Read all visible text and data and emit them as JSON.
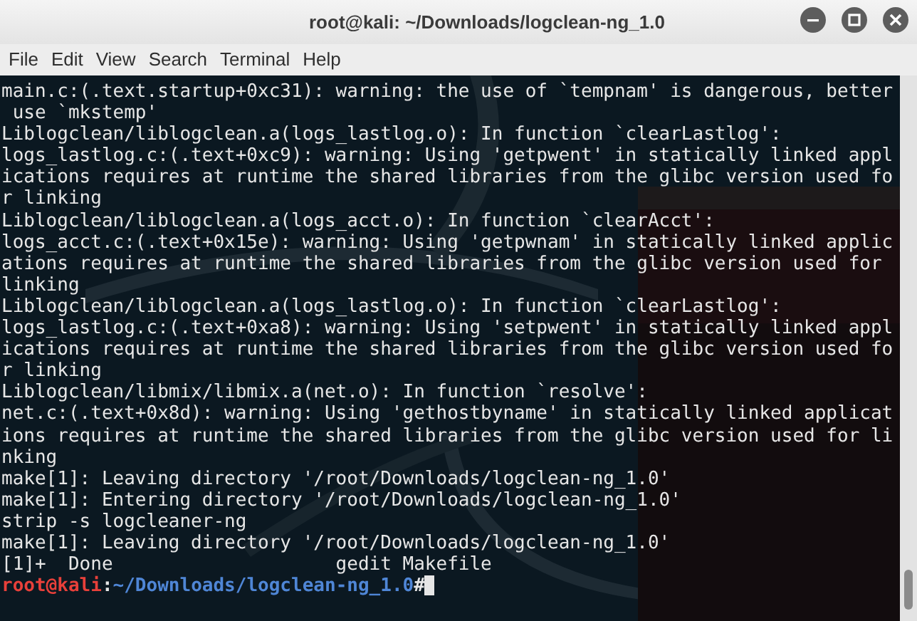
{
  "window": {
    "title": "root@kali: ~/Downloads/logclean-ng_1.0",
    "controls": [
      {
        "kind": "minimize"
      },
      {
        "kind": "maximize"
      },
      {
        "kind": "close"
      }
    ]
  },
  "menu": [
    "File",
    "Edit",
    "View",
    "Search",
    "Terminal",
    "Help"
  ],
  "lines": [
    "main.c:(.text.startup+0xc31): warning: the use of `tempnam' is dangerous, better",
    " use `mkstemp'",
    "Liblogclean/liblogclean.a(logs_lastlog.o): In function `clearLastlog':",
    "logs_lastlog.c:(.text+0xc9): warning: Using 'getpwent' in statically linked appl",
    "ications requires at runtime the shared libraries from the glibc version used fo",
    "r linking",
    "Liblogclean/liblogclean.a(logs_acct.o): In function `clearAcct':",
    "logs_acct.c:(.text+0x15e): warning: Using 'getpwnam' in statically linked applic",
    "ations requires at runtime the shared libraries from the glibc version used for",
    "linking",
    "Liblogclean/liblogclean.a(logs_lastlog.o): In function `clearLastlog':",
    "logs_lastlog.c:(.text+0xa8): warning: Using 'setpwent' in statically linked appl",
    "ications requires at runtime the shared libraries from the glibc version used fo",
    "r linking",
    "Liblogclean/libmix/libmix.a(net.o): In function `resolve':",
    "net.c:(.text+0x8d): warning: Using 'gethostbyname' in statically linked applicat",
    "ions requires at runtime the shared libraries from the glibc version used for li",
    "nking",
    "make[1]: Leaving directory '/root/Downloads/logclean-ng_1.0'",
    "make[1]: Entering directory '/root/Downloads/logclean-ng_1.0'",
    "strip -s logcleaner-ng",
    "make[1]: Leaving directory '/root/Downloads/logclean-ng_1.0'",
    "[1]+  Done                    gedit Makefile"
  ],
  "prompt": {
    "user_host": "root@kali",
    "separator": ":",
    "path": "~/Downloads/logclean-ng_1.0",
    "symbol": "#"
  }
}
